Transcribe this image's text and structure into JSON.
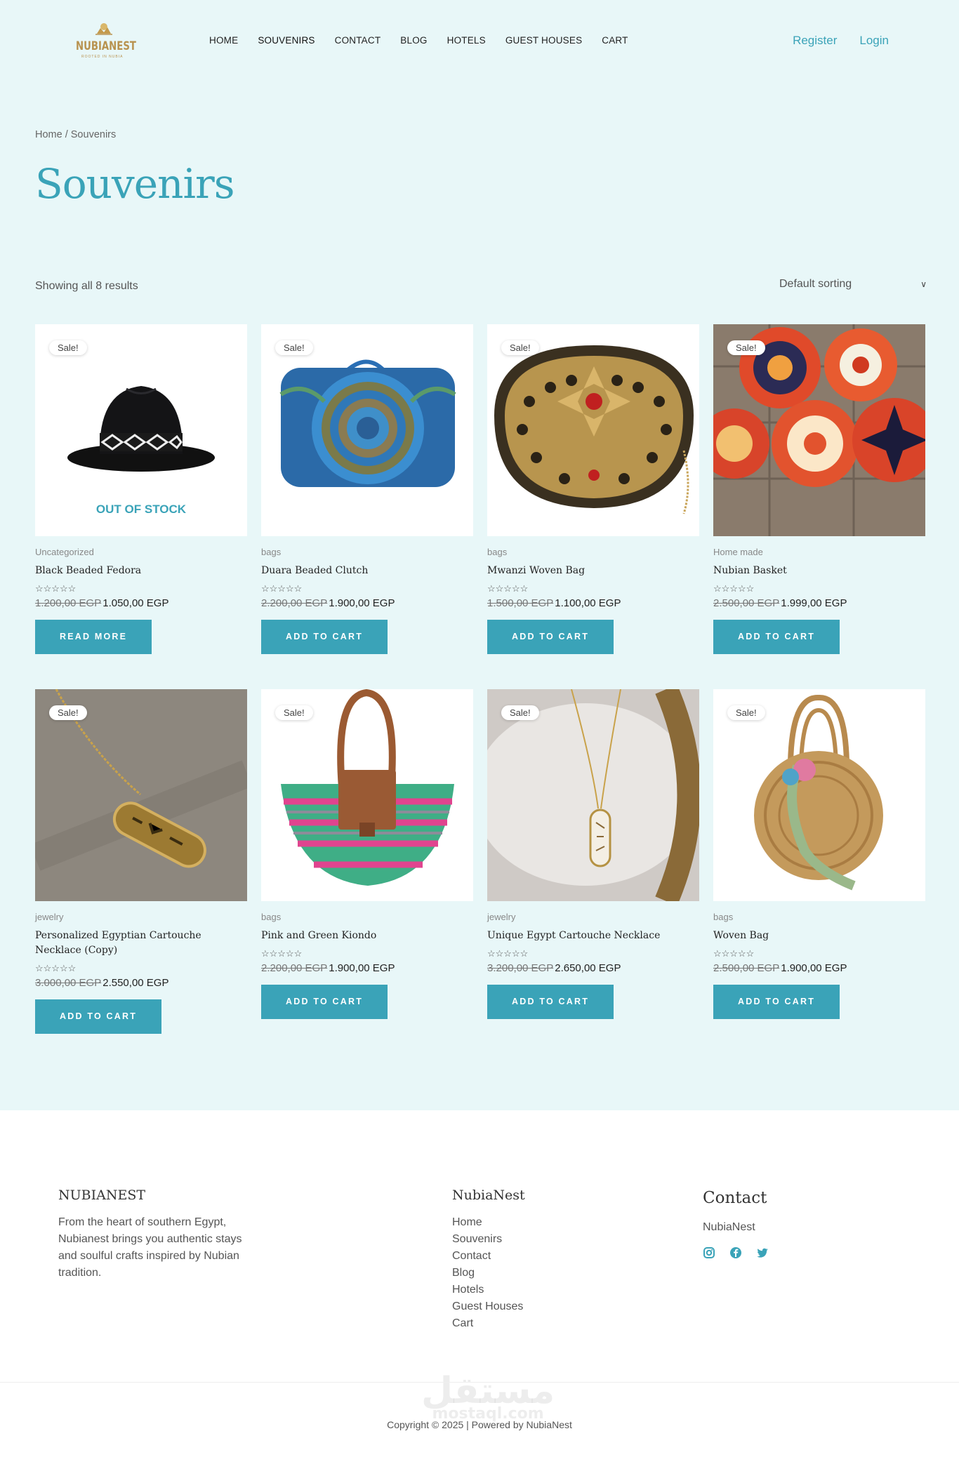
{
  "header": {
    "logo_brand": "NUBIANEST",
    "logo_tagline": "ROOTED IN NUBIA",
    "nav": [
      "HOME",
      "SOUVENIRS",
      "CONTACT",
      "BLOG",
      "HOTELS",
      "GUEST HOUSES",
      "CART"
    ],
    "active_nav": "SOUVENIRS",
    "register_label": "Register",
    "login_label": "Login"
  },
  "page": {
    "breadcrumb": "Home / Souvenirs",
    "title": "Souvenirs",
    "result_count": "Showing all 8 results",
    "sorting_selected": "Default sorting"
  },
  "products": [
    {
      "sale": "Sale!",
      "category": "Uncategorized",
      "name": "Black Beaded Fedora",
      "rating": "☆☆☆☆☆",
      "old_price": "1.200,00 EGP",
      "price": "1.050,00 EGP",
      "button": "READ MORE",
      "badge": "OUT OF STOCK"
    },
    {
      "sale": "Sale!",
      "category": "bags",
      "name": "Duara Beaded Clutch",
      "rating": "☆☆☆☆☆",
      "old_price": "2.200,00 EGP",
      "price": "1.900,00 EGP",
      "button": "ADD TO CART"
    },
    {
      "sale": "Sale!",
      "category": "bags",
      "name": "Mwanzi Woven Bag",
      "rating": "☆☆☆☆☆",
      "old_price": "1.500,00 EGP",
      "price": "1.100,00 EGP",
      "button": "ADD TO CART"
    },
    {
      "sale": "Sale!",
      "category": "Home made",
      "name": "Nubian Basket",
      "rating": "☆☆☆☆☆",
      "old_price": "2.500,00 EGP",
      "price": "1.999,00 EGP",
      "button": "ADD TO CART"
    },
    {
      "sale": "Sale!",
      "category": "jewelry",
      "name": "Personalized Egyptian Cartouche Necklace (Copy)",
      "rating": "☆☆☆☆☆",
      "old_price": "3.000,00 EGP",
      "price": "2.550,00 EGP",
      "button": "ADD TO CART"
    },
    {
      "sale": "Sale!",
      "category": "bags",
      "name": "Pink and Green Kiondo",
      "rating": "☆☆☆☆☆",
      "old_price": "2.200,00 EGP",
      "price": "1.900,00 EGP",
      "button": "ADD TO CART"
    },
    {
      "sale": "Sale!",
      "category": "jewelry",
      "name": "Unique Egypt Cartouche Necklace",
      "rating": "☆☆☆☆☆",
      "old_price": "3.200,00 EGP",
      "price": "2.650,00 EGP",
      "button": "ADD TO CART"
    },
    {
      "sale": "Sale!",
      "category": "bags",
      "name": "Woven Bag",
      "rating": "☆☆☆☆☆",
      "old_price": "2.500,00 EGP",
      "price": "1.900,00 EGP",
      "button": "ADD TO CART"
    }
  ],
  "footer": {
    "about_title": "NUBIANEST",
    "about_text": "From the heart of southern Egypt, Nubianest brings you authentic stays and soulful crafts inspired by Nubian tradition.",
    "links_title": "NubiaNest",
    "links": [
      "Home",
      "Souvenirs",
      "Contact",
      "Blog",
      "Hotels",
      "Guest Houses",
      "Cart"
    ],
    "contact_title": "Contact",
    "contact_text": "NubiaNest",
    "social_icons": [
      "instagram-icon",
      "facebook-icon",
      "twitter-icon"
    ],
    "copyright": "Copyright © 2025 | Powered by NubiaNest",
    "watermark": "مستقل",
    "watermark_sub": "mostaql.com"
  },
  "colors": {
    "accent": "#3aa3b8",
    "page_bg": "#e8f7f8",
    "gold": "#b8924f"
  }
}
